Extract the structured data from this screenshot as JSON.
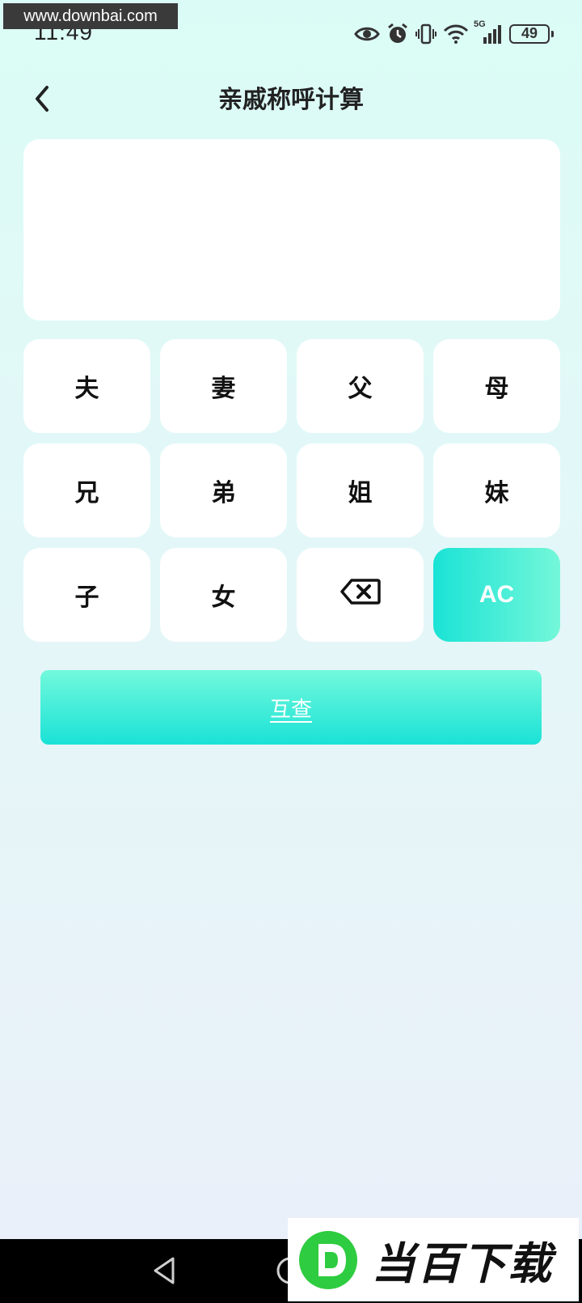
{
  "watermark": {
    "url": "www.downbai.com",
    "logo_text": "当百下载"
  },
  "status_bar": {
    "time": "11:49",
    "network": "5G",
    "battery": "49",
    "icons": [
      "eye-icon",
      "alarm-icon",
      "vibrate-icon",
      "wifi-icon",
      "signal-icon",
      "battery-icon"
    ]
  },
  "header": {
    "title": "亲戚称呼计算",
    "back_icon": "chevron-left-icon"
  },
  "display": {
    "text": ""
  },
  "keypad": {
    "keys": [
      "夫",
      "妻",
      "父",
      "母",
      "兄",
      "弟",
      "姐",
      "妹",
      "子",
      "女"
    ],
    "backspace_icon": "backspace-icon",
    "clear_label": "AC"
  },
  "query_button": {
    "label": "互查"
  },
  "nav_bar": {
    "icons": [
      "nav-back-icon",
      "nav-home-icon"
    ]
  },
  "colors": {
    "accent_start": "#1ae3d5",
    "accent_end": "#74f7d9",
    "background_top": "#dbfcf6",
    "background_bottom": "#eaf0f9"
  }
}
